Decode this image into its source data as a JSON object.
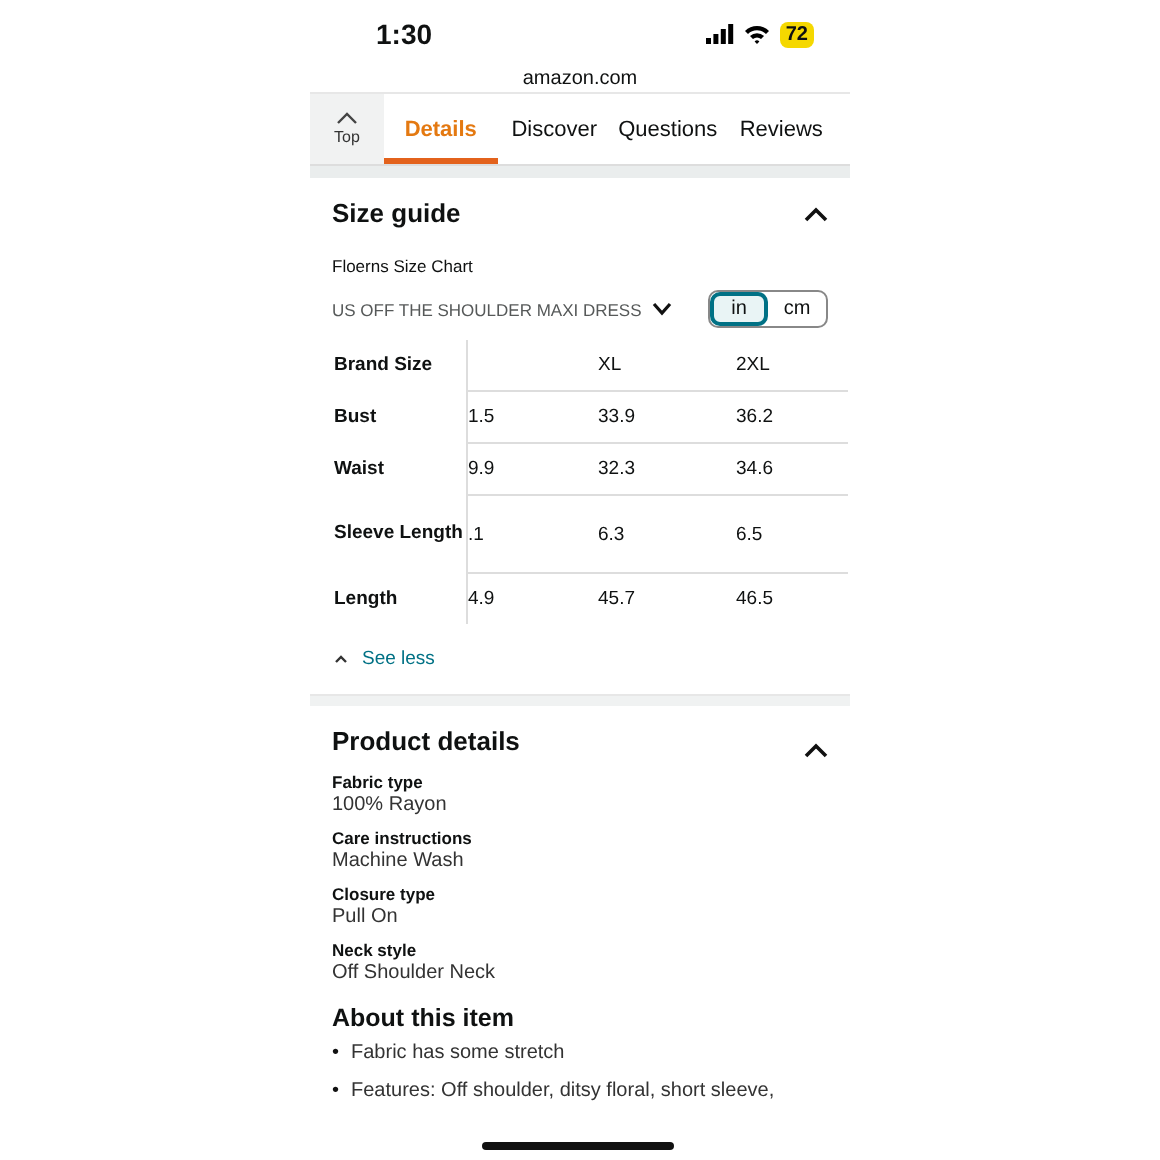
{
  "status_bar": {
    "time": "1:30",
    "battery": "72"
  },
  "address": "amazon.com",
  "top_button": {
    "label": "Top"
  },
  "tabs": [
    {
      "label": "Details",
      "selected": true
    },
    {
      "label": "Discover",
      "selected": false
    },
    {
      "label": "Questions",
      "selected": false
    },
    {
      "label": "Reviews",
      "selected": false
    }
  ],
  "size_guide": {
    "title": "Size guide",
    "expanded": true,
    "chart_name": "Floerns Size Chart",
    "product": "US OFF THE SHOULDER MAXI DRESS",
    "units": [
      {
        "label": "in",
        "selected": true
      },
      {
        "label": "cm",
        "selected": false
      }
    ],
    "table": {
      "columns": [
        "Brand Size",
        "",
        "XL",
        "2XL"
      ],
      "rows": [
        [
          "Bust",
          "1.5",
          "33.9",
          "36.2"
        ],
        [
          "Waist",
          "9.9",
          "32.3",
          "34.6"
        ],
        [
          "Sleeve Length",
          ".1",
          "6.3",
          "6.5"
        ],
        [
          "Length",
          "4.9",
          "45.7",
          "46.5"
        ]
      ]
    },
    "see_less": "See less"
  },
  "product_details": {
    "title": "Product details",
    "expanded": true,
    "items": [
      {
        "label": "Fabric type",
        "value": "100% Rayon"
      },
      {
        "label": "Care instructions",
        "value": "Machine Wash"
      },
      {
        "label": "Closure type",
        "value": "Pull On"
      },
      {
        "label": "Neck style",
        "value": "Off Shoulder Neck"
      }
    ]
  },
  "about": {
    "title": "About this item",
    "bullets": [
      {
        "marker": "•",
        "text": "Fabric has some stretch"
      },
      {
        "marker": "•",
        "text": "Features: Off shoulder, ditsy floral, short sleeve,"
      }
    ]
  }
}
